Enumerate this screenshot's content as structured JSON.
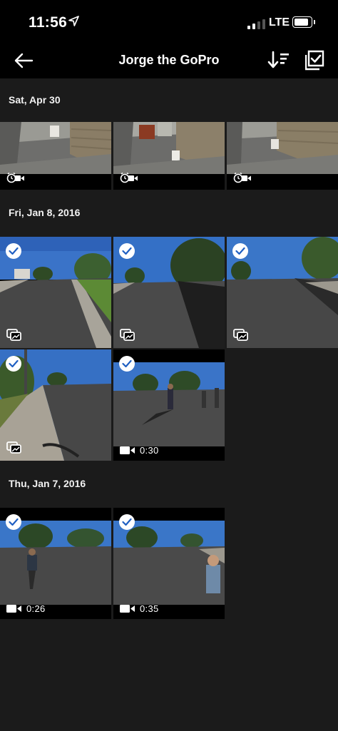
{
  "status": {
    "time": "11:56",
    "network": "LTE"
  },
  "header": {
    "title": "Jorge the GoPro"
  },
  "sections": [
    {
      "date": "Sat, Apr 30"
    },
    {
      "date": "Fri, Jan 8, 2016"
    },
    {
      "date": "Thu, Jan 7, 2016"
    }
  ],
  "videos": [
    {
      "duration": "0:30"
    },
    {
      "duration": "0:26"
    },
    {
      "duration": "0:35"
    }
  ]
}
